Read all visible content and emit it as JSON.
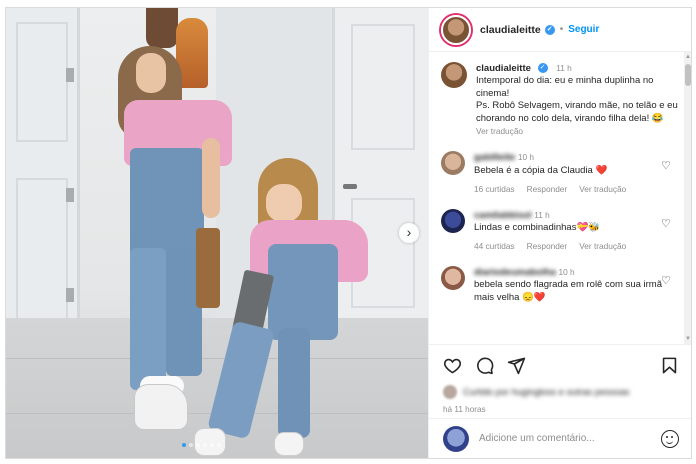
{
  "post": {
    "username": "claudialeitte",
    "separator": "•",
    "follow_label": "Seguir",
    "verified_icon": "check-icon"
  },
  "caption": {
    "username": "claudialeitte",
    "time": "11 h",
    "text": "Intemporal do dia: eu e minha duplinha no cinema!",
    "ps": "Ps. Robô Selvagem, virando mãe, no telão e eu chorando no colo dela, virando filha dela! 😂",
    "translate_label": "Ver tradução"
  },
  "comments": [
    {
      "username": "gabilleite",
      "time": "10 h",
      "text": "Bebela é a cópia da Claudia ❤️",
      "likes": "16 curtidas",
      "reply_label": "Responder",
      "translate_label": "Ver tradução"
    },
    {
      "username": "camilabbisol",
      "time": "11 h",
      "text": "Lindas e combinadinhas💝🐝",
      "likes": "44 curtidas",
      "reply_label": "Responder",
      "translate_label": "Ver tradução"
    },
    {
      "username": "diariodeumabolha",
      "time": "10 h",
      "text": "bebela sendo flagrada em rolê com sua irmã mais velha 😞❤️"
    }
  ],
  "footer": {
    "liked_by": "Curtido por hugingloss e outras pessoas",
    "date": "há 11 horas",
    "comment_placeholder": "Adicione um comentário..."
  },
  "carousel": {
    "slide_count": 6,
    "active_index": 0,
    "next_icon": "chevron-right-icon"
  },
  "icons": {
    "like": "heart-icon",
    "comment": "comment-bubble-icon",
    "share": "paper-plane-icon",
    "save": "bookmark-icon",
    "emoji": "emoji-icon"
  },
  "colors": {
    "follow": "#0095f6",
    "verified": "#3897f0",
    "carousel_dot_active": "#2f9bf0"
  }
}
